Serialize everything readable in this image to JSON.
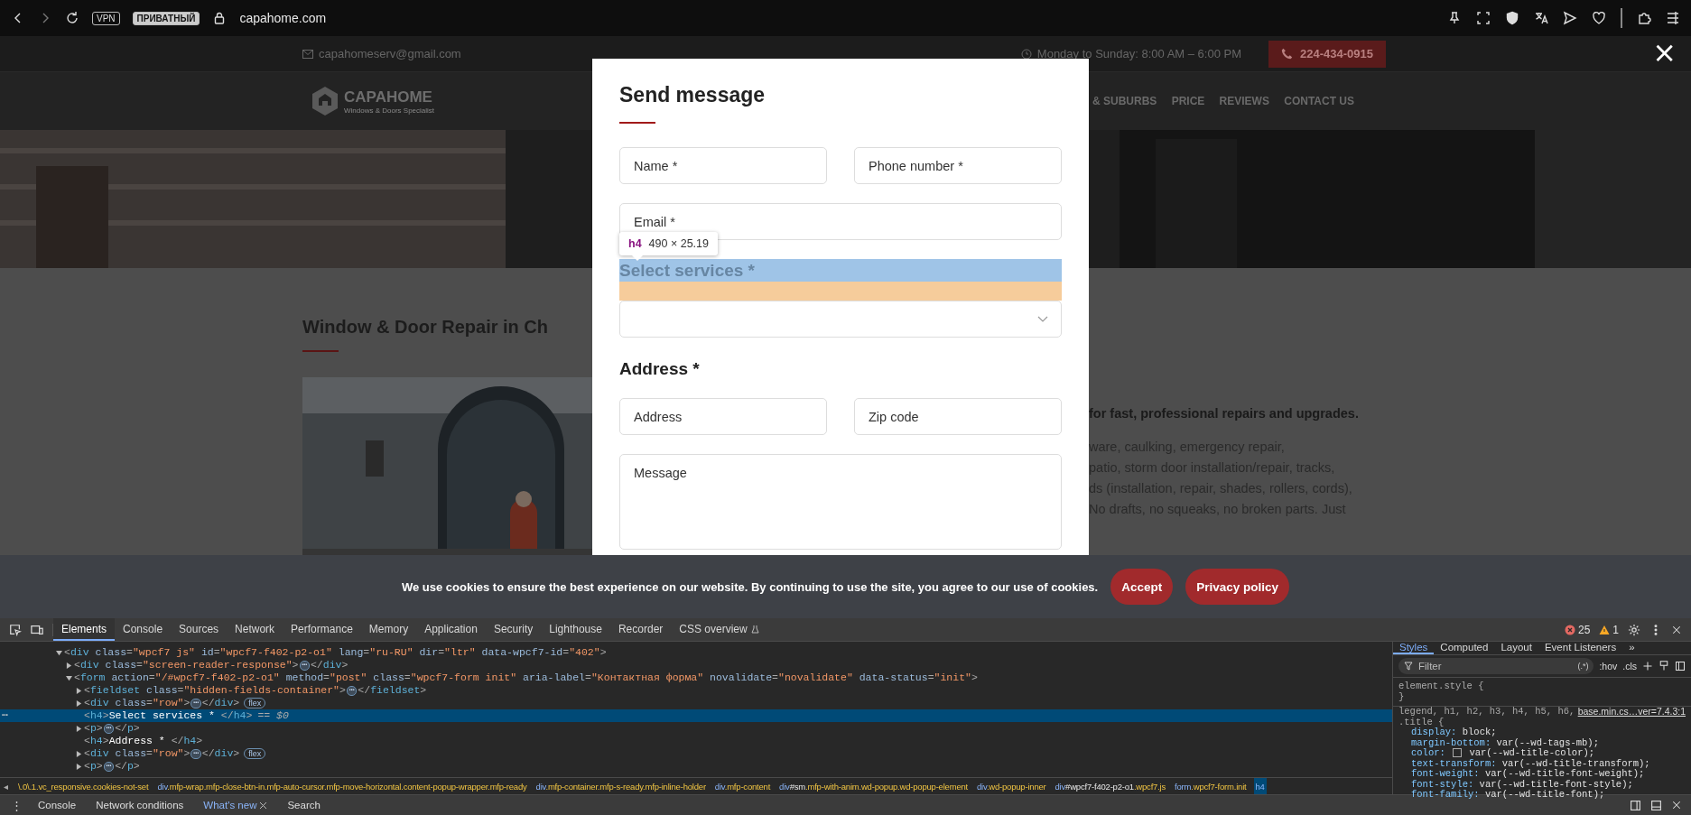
{
  "browser": {
    "badges": [
      "VPN",
      "ПРИВАТНЫЙ"
    ],
    "url": "capahome.com"
  },
  "site": {
    "email": "capahomeserv@gmail.com",
    "hours": "Monday to Sunday: 8:00 AM – 6:00 PM",
    "phone": "224-434-0915",
    "logo_name": "CAPAHOME",
    "logo_tagline": "Windows & Doors Specialist",
    "nav": [
      "& SUBURBS",
      "PRICE",
      "REVIEWS",
      "CONTACT US"
    ],
    "heading": "Window & Door Repair in Ch",
    "intro_bold": "for fast, professional repairs and upgrades.",
    "lines": [
      "ware, caulking, emergency repair,",
      "patio, storm door installation/repair, tracks,",
      "ds (installation, repair, shades, rollers, cords),",
      "No drafts, no squeaks, no broken parts. Just"
    ]
  },
  "popup": {
    "title": "Send message",
    "close": "×",
    "contact_fields": [
      {
        "placeholder": "Name *"
      },
      {
        "placeholder": "Phone number *"
      },
      {
        "placeholder": "Email *"
      }
    ],
    "inspector": {
      "tag": "h4",
      "size": "490 × 25.19"
    },
    "services_heading": "Select services *",
    "address_heading": "Address *",
    "address_fields": [
      {
        "placeholder": "Address"
      },
      {
        "placeholder": "Zip code"
      }
    ],
    "message": {
      "placeholder": "Message"
    }
  },
  "cookie": {
    "text": "We use cookies to ensure the best experience on our website. By continuing to use the site, you agree to our use of cookies.",
    "buttons": [
      "Accept",
      "Privacy policy"
    ]
  },
  "devtools": {
    "tabs": [
      {
        "label": "Elements",
        "selected": true
      },
      {
        "label": "Console",
        "selected": false
      },
      {
        "label": "Sources",
        "selected": false
      },
      {
        "label": "Network",
        "selected": false
      },
      {
        "label": "Performance",
        "selected": false
      },
      {
        "label": "Memory",
        "selected": false
      },
      {
        "label": "Application",
        "selected": false
      },
      {
        "label": "Security",
        "selected": false
      },
      {
        "label": "Lighthouse",
        "selected": false
      },
      {
        "label": "Recorder",
        "selected": false
      },
      {
        "label": "CSS overview",
        "selected": false
      }
    ],
    "errors": "25",
    "warnings": "1",
    "tree": [
      {
        "open": "<div class=\"wpcf7 js\" id=\"wpcf7-f402-p2-o1\" lang=\"ru-RU\" dir=\"ltr\" data-wpcf7-id=\"402\">",
        "expanded": true,
        "selected": false,
        "children": [
          {
            "open": "<div class=\"screen-reader-response\">",
            "collapsed": "⋯",
            "close": "</div>",
            "expanded": false,
            "selected": false
          },
          {
            "open": "<form action=\"/#wpcf7-f402-p2-o1\" method=\"post\" class=\"wpcf7-form init\" aria-label=\"Контактная форма\" novalidate=\"novalidate\" data-status=\"init\">",
            "expanded": true,
            "selected": false,
            "children": [
              {
                "open": "<fieldset class=\"hidden-fields-container\">",
                "collapsed": "⋯",
                "close": "</fieldset>",
                "expanded": false,
                "selected": false
              },
              {
                "open": "<div class=\"row\">",
                "collapsed": "⋯",
                "close": "</div>",
                "badge": "flex",
                "expanded": false,
                "selected": false
              },
              {
                "open": "<h4>Select services * </h4>",
                "ref": "== $0",
                "row_menu": "⋯",
                "selected": true
              },
              {
                "open": "<p>",
                "collapsed": "⋯",
                "close": "</p>",
                "expanded": false,
                "selected": false
              },
              {
                "open": "<h4>Address * </h4>",
                "selected": false
              },
              {
                "open": "<div class=\"row\">",
                "collapsed": "⋯",
                "close": "</div>",
                "badge": "flex",
                "expanded": false,
                "selected": false
              },
              {
                "open": "<p>",
                "collapsed": "⋯",
                "close": "</p>",
                "expanded": false,
                "selected": false
              }
            ]
          }
        ]
      }
    ],
    "scroll_left": "◂",
    "breadcrumbs": [
      {
        "label": "\\.0\\.1.vc_responsive.cookies-not-set",
        "selected": false
      },
      {
        "label": "div.mfp-wrap.mfp-close-btn-in.mfp-auto-cursor.mfp-move-horizontal.content-popup-wrapper.mfp-ready",
        "selected": false
      },
      {
        "label": "div.mfp-container.mfp-s-ready.mfp-inline-holder",
        "selected": false
      },
      {
        "label": "div.mfp-content",
        "selected": false
      },
      {
        "label": "div#sm.mfp-with-anim.wd-popup.wd-popup-element",
        "selected": false
      },
      {
        "label": "div.wd-popup-inner",
        "selected": false
      },
      {
        "label": "div#wpcf7-f402-p2-o1.wpcf7.js",
        "selected": false
      },
      {
        "label": "form.wpcf7-form.init",
        "selected": false
      },
      {
        "label": "h4",
        "selected": true
      }
    ],
    "styles": {
      "tabs": [
        {
          "label": "Styles",
          "selected": true
        },
        {
          "label": "Computed",
          "selected": false
        },
        {
          "label": "Layout",
          "selected": false
        },
        {
          "label": "Event Listeners",
          "selected": false
        }
      ],
      "more": "»",
      "filter_placeholder": "Filter",
      "regex": "(.*)",
      "hov": ":hov",
      "cls": ".cls",
      "element_rule": "element.style {",
      "element_close": "}",
      "selector_lines": [
        "legend, h1, h2, h3, h4, h5, h6,",
        ".title {"
      ],
      "source": "base.min.cs…ver=7.4.3:1",
      "properties": [
        {
          "text": "display: block;",
          "swatch": false
        },
        {
          "text": "margin-bottom: var(--wd-tags-mb);",
          "swatch": false
        },
        {
          "text": "color: var(--wd-title-color);",
          "swatch": true
        },
        {
          "text": "text-transform: var(--wd-title-transform);",
          "swatch": false
        },
        {
          "text": "font-weight: var(--wd-title-font-weight);",
          "swatch": false
        },
        {
          "text": "font-style: var(--wd-title-font-style);",
          "swatch": false
        },
        {
          "text": "font-family: var(--wd-title-font);",
          "swatch": false
        }
      ]
    },
    "drawer": {
      "menu": "⋮",
      "tabs": [
        {
          "label": "Console",
          "selected": false,
          "closable": false
        },
        {
          "label": "Network conditions",
          "selected": false,
          "closable": false
        },
        {
          "label": "What's new",
          "selected": true,
          "closable": true
        },
        {
          "label": "Search",
          "selected": false,
          "closable": false
        }
      ]
    }
  }
}
